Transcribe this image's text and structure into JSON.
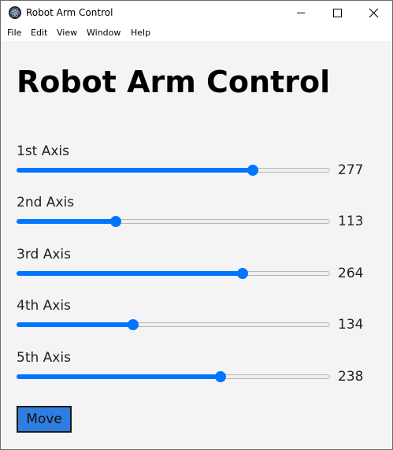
{
  "window": {
    "title": "Robot Arm Control"
  },
  "menu": {
    "items": [
      "File",
      "Edit",
      "View",
      "Window",
      "Help"
    ]
  },
  "page": {
    "title": "Robot Arm Control"
  },
  "axes": [
    {
      "label": "1st Axis",
      "value": "277",
      "fraction": 0.753
    },
    {
      "label": "2nd Axis",
      "value": "113",
      "fraction": 0.317
    },
    {
      "label": "3rd Axis",
      "value": "264",
      "fraction": 0.72
    },
    {
      "label": "4th Axis",
      "value": "134",
      "fraction": 0.372
    },
    {
      "label": "5th Axis",
      "value": "238",
      "fraction": 0.65
    }
  ],
  "move_button": {
    "label": "Move"
  },
  "colors": {
    "accent": "#0075ff",
    "button": "#2e7de0",
    "background": "#f4f4f4"
  }
}
